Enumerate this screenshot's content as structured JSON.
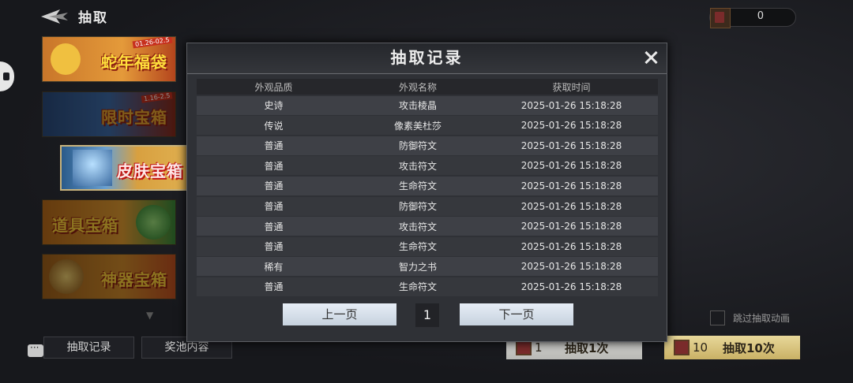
{
  "header": {
    "title": "抽取",
    "currency_value": "0"
  },
  "categories": [
    {
      "label": "蛇年福袋",
      "banner": "01.26-02.5"
    },
    {
      "label": "限时宝箱",
      "banner": "1.16-2.5"
    },
    {
      "label": "皮肤宝箱"
    },
    {
      "label": "道具宝箱"
    },
    {
      "label": "神器宝箱"
    }
  ],
  "bottom": {
    "records_label": "抽取记录",
    "pool_label": "奖池内容",
    "skip_label": "跳过抽取动画",
    "draw1": {
      "count": "1",
      "label": "抽取1次"
    },
    "draw10": {
      "count": "10",
      "label": "抽取10次"
    }
  },
  "modal": {
    "title": "抽取记录",
    "columns": [
      "外观品质",
      "外观名称",
      "获取时间"
    ],
    "rows": [
      [
        "史诗",
        "攻击棱晶",
        "2025-01-26 15:18:28"
      ],
      [
        "传说",
        "像素美杜莎",
        "2025-01-26 15:18:28"
      ],
      [
        "普通",
        "防御符文",
        "2025-01-26 15:18:28"
      ],
      [
        "普通",
        "攻击符文",
        "2025-01-26 15:18:28"
      ],
      [
        "普通",
        "生命符文",
        "2025-01-26 15:18:28"
      ],
      [
        "普通",
        "防御符文",
        "2025-01-26 15:18:28"
      ],
      [
        "普通",
        "攻击符文",
        "2025-01-26 15:18:28"
      ],
      [
        "普通",
        "生命符文",
        "2025-01-26 15:18:28"
      ],
      [
        "稀有",
        "智力之书",
        "2025-01-26 15:18:28"
      ],
      [
        "普通",
        "生命符文",
        "2025-01-26 15:18:28"
      ]
    ],
    "prev_label": "上一页",
    "next_label": "下一页",
    "page": "1"
  }
}
